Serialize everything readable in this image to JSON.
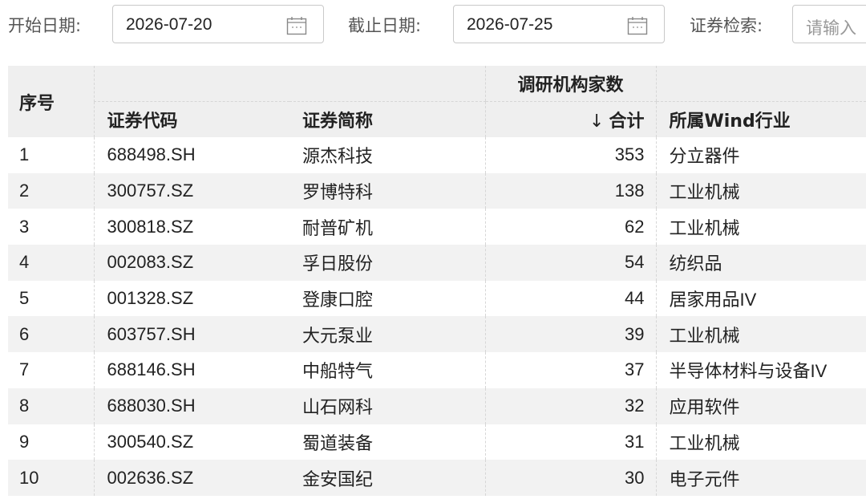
{
  "filters": {
    "start_label": "开始日期:",
    "start_date": "2026-07-20",
    "end_label": "截止日期:",
    "end_date": "2026-07-25",
    "search_label": "证券检索:",
    "search_placeholder": "请输入"
  },
  "table": {
    "headers": {
      "index": "序号",
      "group": "调研机构家数",
      "code": "证券代码",
      "name": "证券简称",
      "sort_arrow": "↓",
      "total": "合计",
      "industry": "所属Wind行业"
    },
    "rows": [
      {
        "no": "1",
        "code": "688498.SH",
        "name": "源杰科技",
        "total": "353",
        "industry": "分立器件"
      },
      {
        "no": "2",
        "code": "300757.SZ",
        "name": "罗博特科",
        "total": "138",
        "industry": "工业机械"
      },
      {
        "no": "3",
        "code": "300818.SZ",
        "name": "耐普矿机",
        "total": "62",
        "industry": "工业机械"
      },
      {
        "no": "4",
        "code": "002083.SZ",
        "name": "孚日股份",
        "total": "54",
        "industry": "纺织品"
      },
      {
        "no": "5",
        "code": "001328.SZ",
        "name": "登康口腔",
        "total": "44",
        "industry": "居家用品IV"
      },
      {
        "no": "6",
        "code": "603757.SH",
        "name": "大元泵业",
        "total": "39",
        "industry": "工业机械"
      },
      {
        "no": "7",
        "code": "688146.SH",
        "name": "中船特气",
        "total": "37",
        "industry": "半导体材料与设备IV"
      },
      {
        "no": "8",
        "code": "688030.SH",
        "name": "山石网科",
        "total": "32",
        "industry": "应用软件"
      },
      {
        "no": "9",
        "code": "300540.SZ",
        "name": "蜀道装备",
        "total": "31",
        "industry": "工业机械"
      },
      {
        "no": "10",
        "code": "002636.SZ",
        "name": "金安国纪",
        "total": "30",
        "industry": "电子元件"
      }
    ]
  }
}
